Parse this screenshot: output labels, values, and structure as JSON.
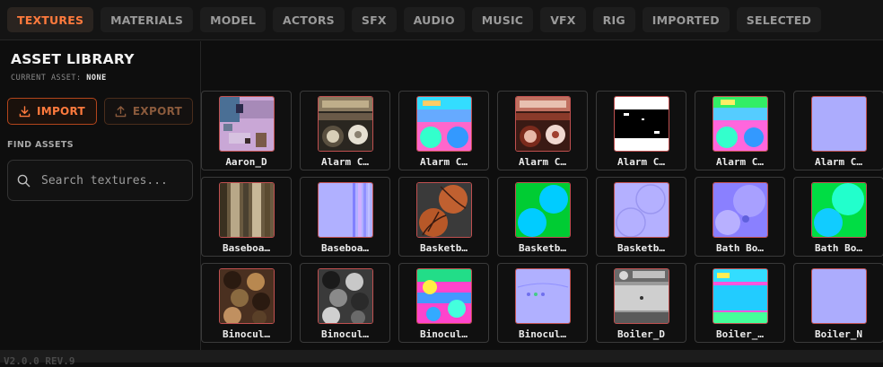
{
  "tabs": [
    {
      "label": "TEXTURES",
      "active": true
    },
    {
      "label": "MATERIALS"
    },
    {
      "label": "MODEL"
    },
    {
      "label": "ACTORS"
    },
    {
      "label": "SFX"
    },
    {
      "label": "AUDIO"
    },
    {
      "label": "MUSIC"
    },
    {
      "label": "VFX"
    },
    {
      "label": "RIG"
    },
    {
      "label": "IMPORTED"
    },
    {
      "label": "SELECTED"
    }
  ],
  "sidebar": {
    "title": "ASSET LIBRARY",
    "current_asset_label": "CURRENT ASSET:",
    "current_asset_value": "NONE",
    "import_label": "IMPORT",
    "export_label": "EXPORT",
    "find_label": "FIND ASSETS",
    "search_placeholder": "Search textures..."
  },
  "assets": [
    {
      "label": "Aaron_D",
      "thumb": "aaron"
    },
    {
      "label": "Alarm C…",
      "thumb": "alarm-diffuse"
    },
    {
      "label": "Alarm C…",
      "thumb": "alarm-colormap"
    },
    {
      "label": "Alarm C…",
      "thumb": "alarm-red"
    },
    {
      "label": "Alarm C…",
      "thumb": "alarm-mask"
    },
    {
      "label": "Alarm C…",
      "thumb": "alarm-colormap2"
    },
    {
      "label": "Alarm C…",
      "thumb": "normal-flat"
    },
    {
      "label": "Baseboa…",
      "thumb": "baseboard-diffuse"
    },
    {
      "label": "Baseboa…",
      "thumb": "baseboard-normal"
    },
    {
      "label": "Basketb…",
      "thumb": "basketball-diffuse"
    },
    {
      "label": "Basketb…",
      "thumb": "basketball-colormap"
    },
    {
      "label": "Basketb…",
      "thumb": "basketball-normal"
    },
    {
      "label": "Bath Bo…",
      "thumb": "bath-normal"
    },
    {
      "label": "Bath Bo…",
      "thumb": "bath-colormap"
    },
    {
      "label": "Binocul…",
      "thumb": "binoculars-diffuse"
    },
    {
      "label": "Binocul…",
      "thumb": "binoculars-gray"
    },
    {
      "label": "Binocul…",
      "thumb": "binoculars-colormap"
    },
    {
      "label": "Binocul…",
      "thumb": "binoculars-normal"
    },
    {
      "label": "Boiler_D",
      "thumb": "boiler-diffuse"
    },
    {
      "label": "Boiler_…",
      "thumb": "boiler-colormap"
    },
    {
      "label": "Boiler_N",
      "thumb": "normal-flat"
    }
  ],
  "footer": {
    "text": "V2.0.0 REV.9"
  }
}
